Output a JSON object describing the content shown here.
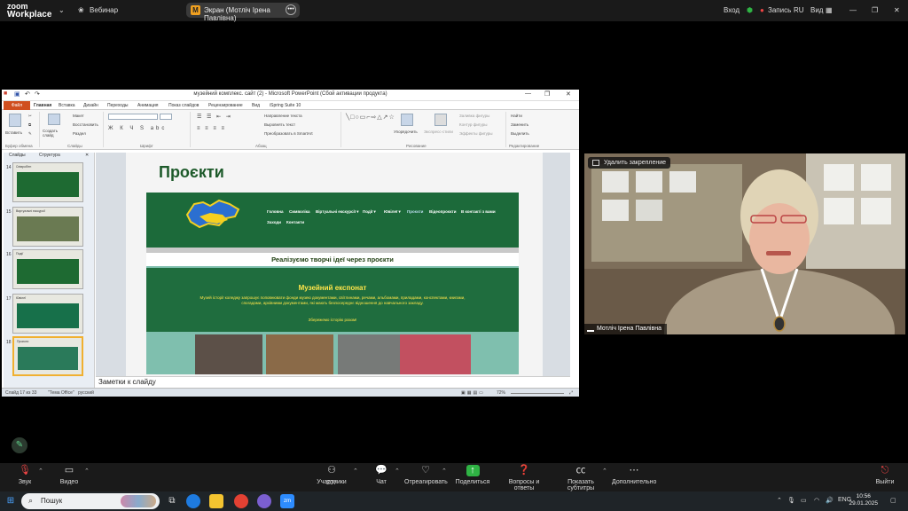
{
  "zoom_top": {
    "logo_line1": "zoom",
    "logo_line2": "Workplace",
    "webinar_label": "Вебинар",
    "share_label": "Экран (Мотліч Ірена Павлівна)",
    "login_label": "Вход",
    "record_label": "Запись",
    "lang": "RU",
    "view_label": "Вид"
  },
  "ppt": {
    "title": "музейний комплекс. сайт (2) - Microsoft PowerPoint (Сбой активации продукта)",
    "tabs": [
      "Файл",
      "Главная",
      "Вставка",
      "Дизайн",
      "Переходы",
      "Анимация",
      "Показ слайдов",
      "Рецензирование",
      "Вид",
      "iSpring Suite 10"
    ],
    "ribbon": {
      "paste": "Вставить",
      "new_slide": "Создать слайд",
      "layout": "Макет",
      "reset": "Восстановить",
      "section": "Раздел",
      "clipboard": "Буфер обмена",
      "slides": "Слайды",
      "font": "Шрифт",
      "paragraph": "Абзац",
      "text_dir": "Направление текста",
      "align_text": "Выровнять текст",
      "smartart": "Преобразовать в SmartArt",
      "arrange": "Упорядочить",
      "quick_styles": "Экспресс-стили",
      "fill": "Заливка фигуры",
      "outline": "Контур фигуры",
      "effects": "Эффекты фигуры",
      "drawing": "Рисование",
      "find": "Найти",
      "replace": "Заменить",
      "select": "Выделить",
      "editing": "Редактирование"
    },
    "thumb_tabs": [
      "Слайды",
      "Структура"
    ],
    "thumbs": [
      {
        "num": "14",
        "label": "Співробітн"
      },
      {
        "num": "15",
        "label": "Виртуальні екскурсії"
      },
      {
        "num": "16",
        "label": "Події"
      },
      {
        "num": "17",
        "label": "Ювілеї"
      },
      {
        "num": "18",
        "label": "Проєкти"
      }
    ],
    "slide": {
      "title": "Проєкти",
      "nav_row1": [
        "Головна",
        "Символіка",
        "Віртуальні екскурсії ▾",
        "Події ▾",
        "Ювілеї ▾",
        "Проєкти",
        "Відеопроєкти",
        "В контакті з вами"
      ],
      "nav_row2": [
        "Заходи",
        "Контакти"
      ],
      "tagline": "Реалізуємо творчі ідеї через проєкти",
      "subheading": "Музейний експонат",
      "description": "Музей історії коледжу запрошує поповнювати фонди музею документами, світлинами, речами, альбомами, приладами, конспектами, книгами, спогадами, архівними документами, які мають безпосереднє відношення до навчального закладу.",
      "link": "Збережемо історію разом!"
    },
    "notes_placeholder": "Заметки к слайду",
    "status": {
      "slide_of": "Слайд 17 из 33",
      "theme": "\"Тема Office\"",
      "language": "русский",
      "zoom": "72%"
    }
  },
  "video": {
    "unpin_label": "Удалить закрепление",
    "participant_name": "Мотліч Ірена Павлівна"
  },
  "zoom_bottom": {
    "audio": "Звук",
    "video": "Видео",
    "participants_count": "207",
    "participants": "Участники",
    "chat": "Чат",
    "react": "Отреагировать",
    "share": "Поделиться",
    "qa": "Вопросы и ответы",
    "captions": "Показать субтитры",
    "more": "Дополнительно",
    "leave": "Выйти"
  },
  "taskbar": {
    "search_placeholder": "Пошук",
    "lang": "ENG",
    "time": "10:56",
    "date": "29.01.2025"
  },
  "colors": {
    "zoom_bg": "#1a1a1a",
    "ppt_file_tab": "#d04f1f",
    "site_green": "#1c6a3a",
    "accent_yellow": "#ffe54a",
    "record_green": "#2fb344"
  }
}
